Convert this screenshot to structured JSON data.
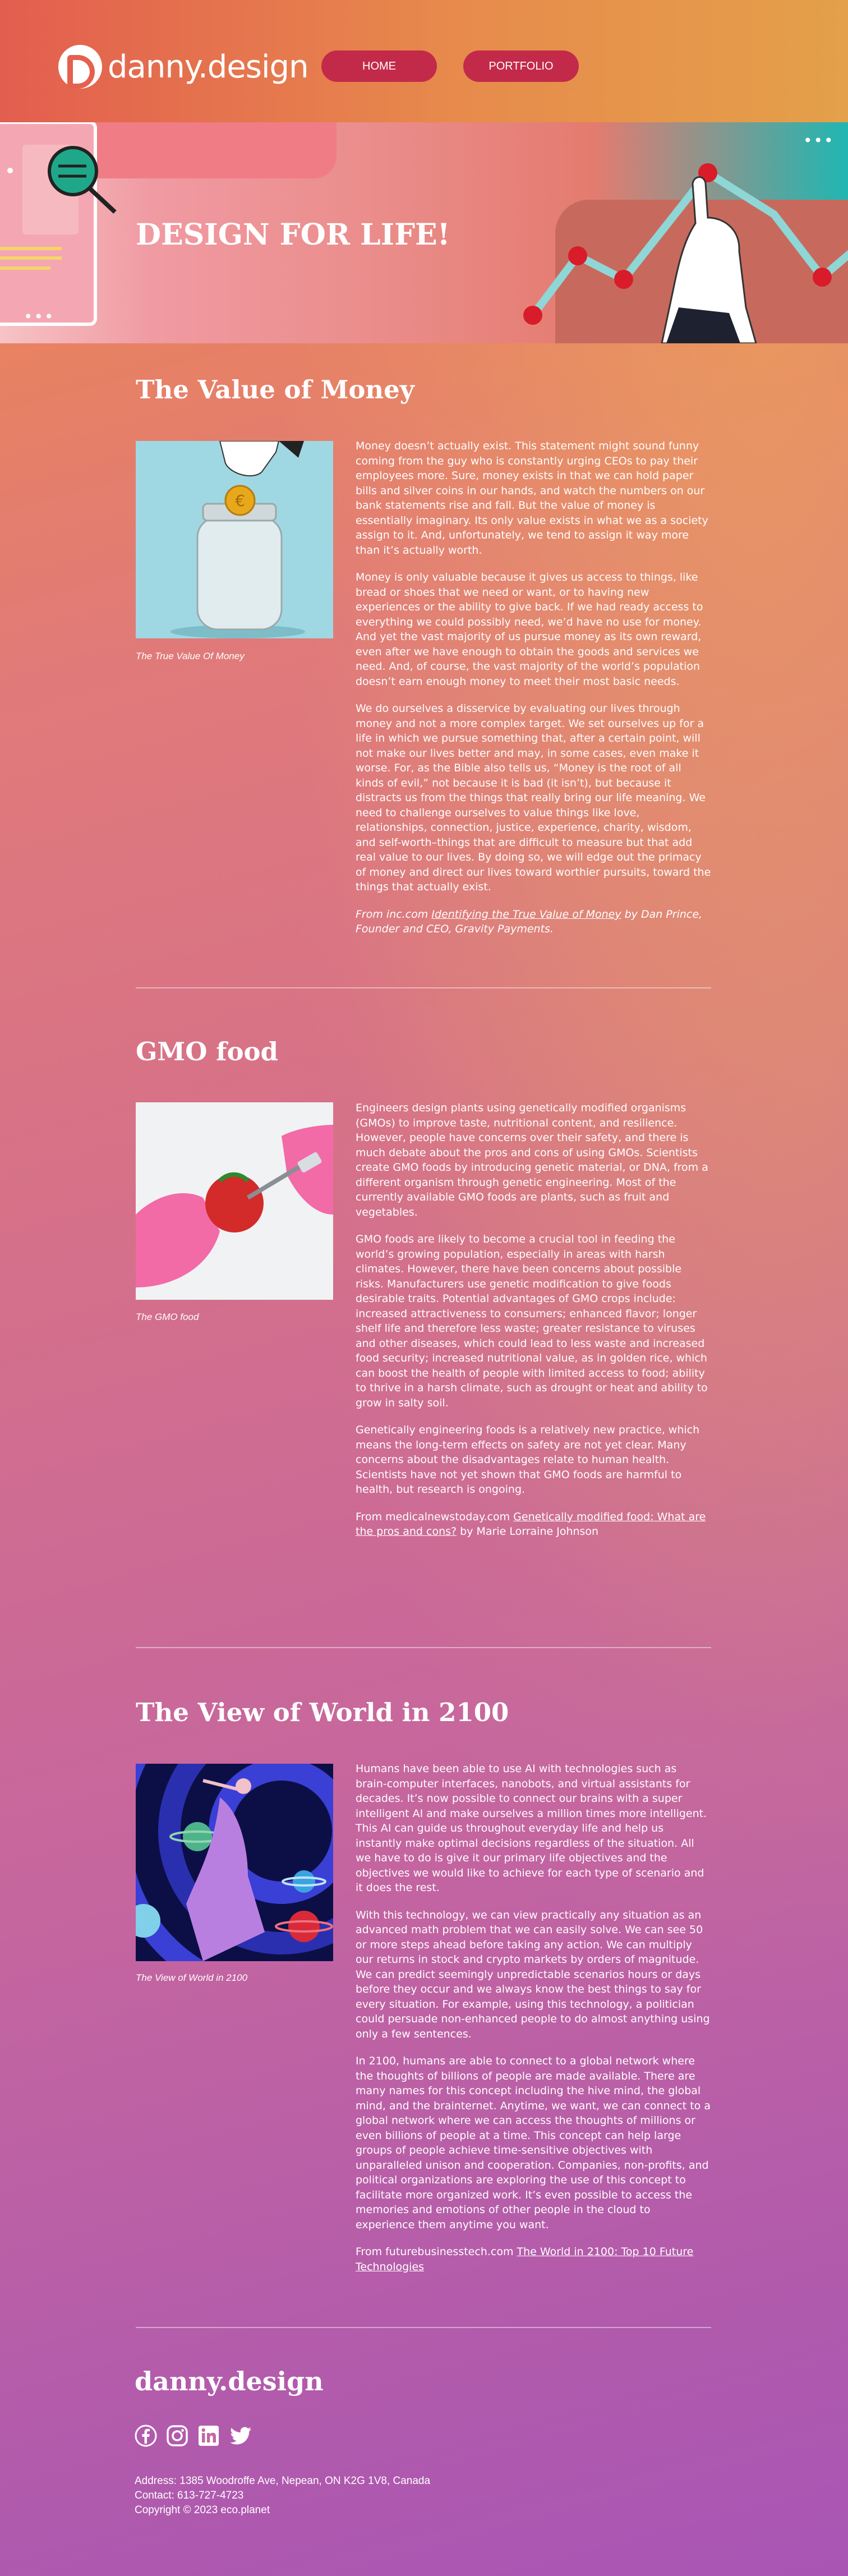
{
  "brand": {
    "logo_text": "danny.design",
    "footer_logo": "danny.design"
  },
  "nav": {
    "items": [
      {
        "label": "HOME"
      },
      {
        "label": "PORTFOLIO"
      }
    ]
  },
  "hero": {
    "title": "DESIGN FOR LIFE!"
  },
  "sections": [
    {
      "title": "The Value of Money",
      "caption": "The True Value Of Money",
      "paragraphs": [
        "Money doesn’t actually exist. This statement might sound funny coming from the guy who is constantly urging CEOs to pay their employees more. Sure, money exists in that we can hold paper bills and silver coins in our hands, and watch the numbers on our bank statements rise and fall. But the value of money is essentially imaginary. Its only value exists in what we as a society assign to it. And, unfortunately, we tend to assign it way more than it’s actually worth.",
        "Money is only valuable because it gives us access to things, like bread or shoes that we need or want, or to having new experiences or the ability to give back. If we had ready access to everything we could possibly need, we’d have no use for money. And yet the vast majority of us pursue money as its own reward, even after we have enough to obtain the goods and services we need. And, of course, the vast majority of the world’s population doesn’t earn enough money to meet their most basic needs.",
        "We do ourselves a disservice by evaluating our lives through money and not a more complex target. We set ourselves up for a life in which we pursue something that, after a certain point, will not make our lives better and may, in some cases, even make it worse. For, as the Bible also tells us, “Money is the root of all kinds of evil,” not because it is bad (it isn’t), but because it distracts us from the things that really bring our life meaning. We need to challenge ourselves to value things like love, relationships, connection, justice, experience, charity, wisdom, and self-worth–things that are difficult to measure but that add real value to our lives. By doing so, we will edge out the primacy of money and direct our lives toward worthier pursuits, toward the things that actually exist."
      ],
      "source_prefix": "From inc.com ",
      "source_link": "Identifying the True Value of Money",
      "source_suffix": " by Dan Prince, Founder and CEO, Gravity Payments."
    },
    {
      "title": "GMO food",
      "caption": "The GMO food",
      "paragraphs": [
        "Engineers design plants using genetically modified organisms (GMOs) to improve taste, nutritional content, and resilience. However, people have concerns over their safety, and there is much debate about the pros and cons of using GMOs. Scientists create GMO foods by introducing genetic material, or DNA, from a different organism through genetic engineering. Most of the currently available GMO foods are plants, such as fruit and vegetables.",
        "GMO foods are likely to become a crucial tool in feeding the world’s growing population, especially in areas with harsh climates. However, there have been concerns about possible risks. Manufacturers use genetic modification to give foods desirable traits. Potential advantages of GMO crops include: increased attractiveness to consumers; enhanced flavor; longer shelf life and therefore less waste; greater resistance to viruses and other diseases, which could lead to less waste and increased food security; increased nutritional value, as in golden rice, which can boost the health of people with limited access to food; ability to thrive in a harsh climate, such as drought or heat and ability to grow in salty soil.",
        "Genetically engineering foods is a relatively new practice, which means the long-term effects on safety are not yet clear. Many concerns about the disadvantages relate to human health. Scientists have not yet shown that GMO foods are harmful to health, but research is ongoing."
      ],
      "source_prefix": "From medicalnewstoday.com ",
      "source_link": "Genetically modified food: What are the pros and cons?",
      "source_suffix": " by Marie Lorraine Johnson"
    },
    {
      "title": "The View of World in 2100",
      "caption": "The View of World in 2100",
      "paragraphs": [
        "Humans have been able to use AI with technologies such as brain-computer interfaces, nanobots, and virtual assistants for decades. It’s now possible to connect our brains with a super intelligent AI and make ourselves a million times more intelligent. This AI can guide us throughout everyday life and help us instantly make optimal decisions regardless of the situation. All we have to do is give it our primary life objectives and the objectives we would like to achieve for each type of scenario and it does the rest.",
        "With this technology, we can view practically any situation as an advanced math problem that we can easily solve. We can see 50 or more steps ahead before taking any action. We can multiply our returns in stock and crypto markets by orders of magnitude. We can predict seemingly unpredictable scenarios hours or days before they occur and we always know the best things to say for every situation. For example, using this technology, a politician could persuade non-enhanced people to do almost anything using only a few sentences.",
        "In 2100, humans are able to connect to a global network where the thoughts of billions of people are made available. There are many names for this concept including the hive mind, the global mind, and the brainternet. Anytime, we want, we can connect to a global network where we can access the thoughts of millions or even billions of people at a time. This concept can help large groups of people achieve time-sensitive objectives with unparalleled unison and cooperation. Companies, non-profits, and political organizations are exploring the use of this concept to facilitate more organized work. It’s even possible to access the memories and emotions of other people in the cloud to experience them anytime you want."
      ],
      "source_prefix": "From futurebusinesstech.com ",
      "source_link": "The World in 2100: Top 10 Future Technologies",
      "source_suffix": ""
    }
  ],
  "footer": {
    "social": [
      "facebook-icon",
      "instagram-icon",
      "linkedin-icon",
      "twitter-icon"
    ],
    "address": "Address: 1385 Woodroffe Ave, Nepean, ON K2G 1V8, Canada",
    "contact": "Contact: 613-727-4723",
    "copyright": "Copyright © 2023 eco.planet"
  }
}
